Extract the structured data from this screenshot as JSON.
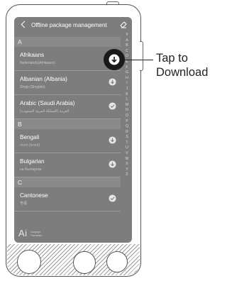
{
  "header": {
    "title": "Offline package management"
  },
  "sections": [
    {
      "letter": "A",
      "items": [
        {
          "name": "Afrikaans",
          "native": "Nederlands(Afrikaans)",
          "status_icon": "download-icon"
        },
        {
          "name": "Albanian (Albania)",
          "native": "Shqip (Shqipëri)",
          "status_icon": "download-icon"
        },
        {
          "name": "Arabic (Saudi Arabia)",
          "native": "العربية (المملكة العربية السعودية)",
          "status_icon": "check-icon"
        }
      ]
    },
    {
      "letter": "B",
      "items": [
        {
          "name": "Bengali",
          "native": "বাংলা (ভারত)",
          "status_icon": "download-icon"
        },
        {
          "name": "Bulgarian",
          "native": "на български",
          "status_icon": "download-icon"
        }
      ]
    },
    {
      "letter": "C",
      "items": [
        {
          "name": "Cantonese",
          "native": "粤语",
          "status_icon": "check-icon"
        }
      ]
    }
  ],
  "alphabet": [
    "#",
    "A",
    "B",
    "C",
    "D",
    "E",
    "F",
    "G",
    "H",
    "I",
    "J",
    "K",
    "L",
    "M",
    "N",
    "O",
    "P",
    "Q",
    "R",
    "S",
    "T",
    "U",
    "V",
    "W",
    "X",
    "Y",
    "Z"
  ],
  "logo": {
    "mark": "Ai",
    "line1": "Langogo",
    "line2": "Translator"
  },
  "callout": {
    "line1": "Tap to",
    "line2": "Download"
  }
}
